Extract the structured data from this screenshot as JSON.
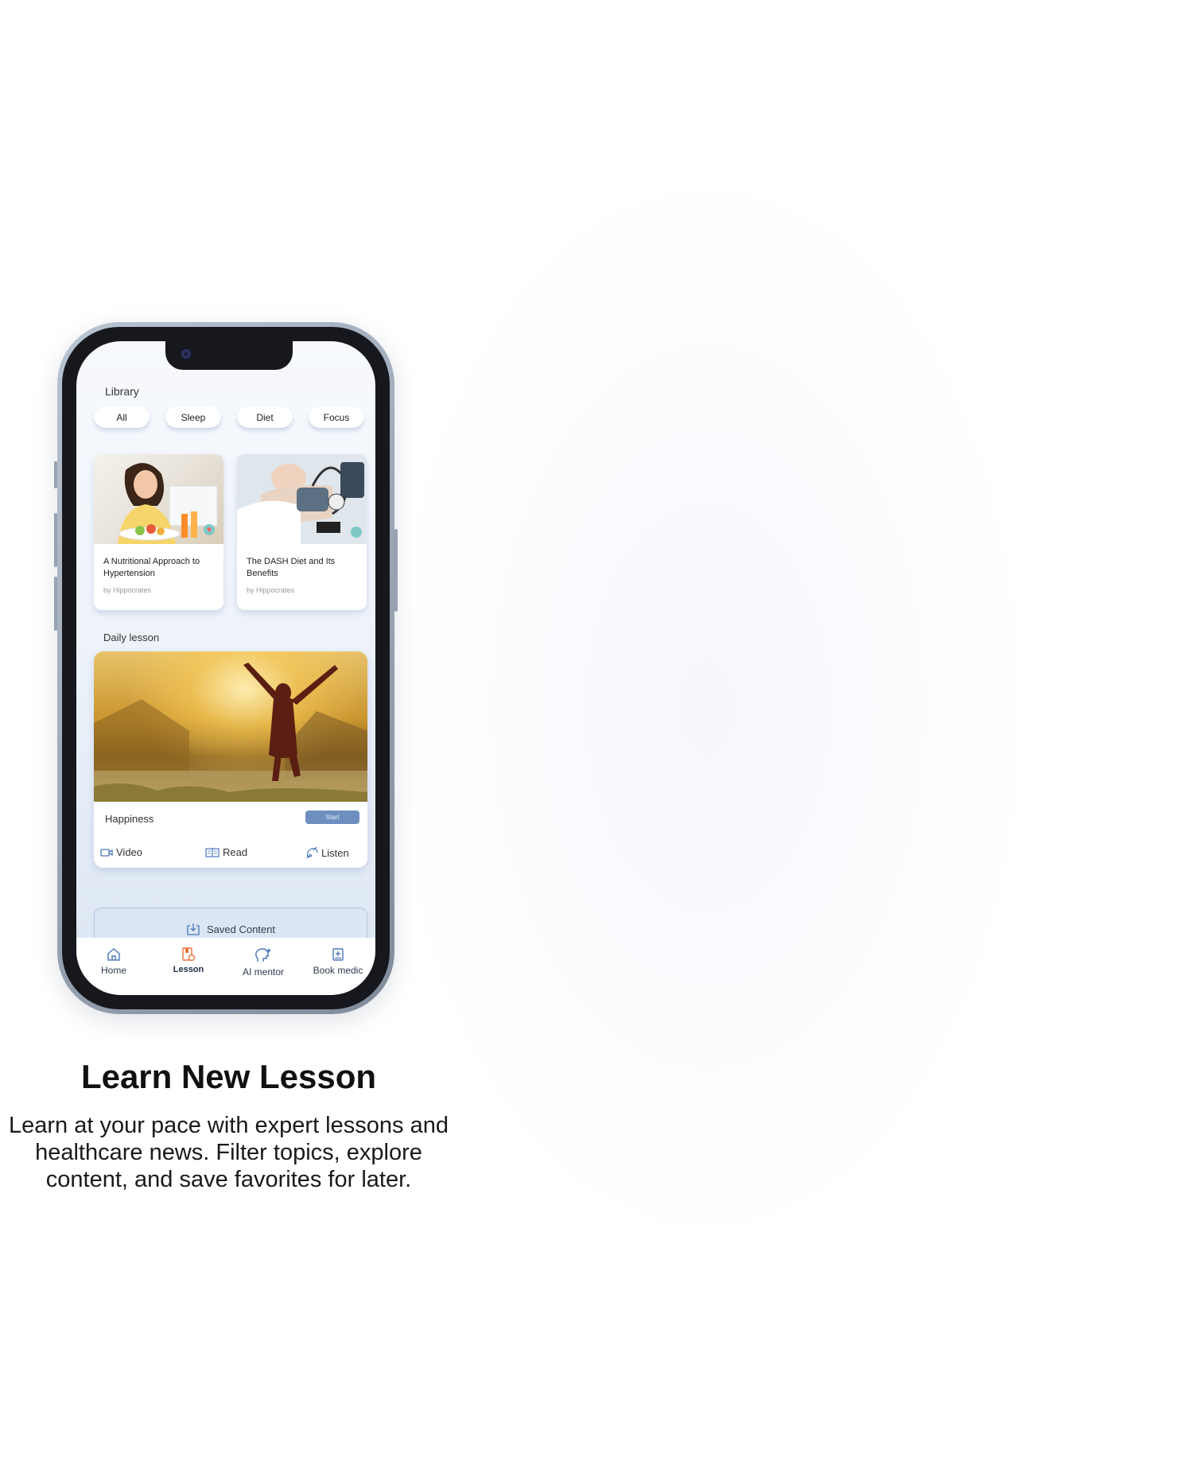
{
  "library": {
    "title": "Library",
    "chips": [
      "All",
      "Sleep",
      "Diet",
      "Focus"
    ]
  },
  "cards": [
    {
      "title": "A Nutritional Approach to Hypertension",
      "author": "by Hippocrates"
    },
    {
      "title": "The DASH Diet and Its Benefits",
      "author": "by Hippocrates"
    }
  ],
  "daily": {
    "title": "Daily lesson",
    "lesson_name": "Happiness",
    "start_label": "Start",
    "actions": {
      "video": "Video",
      "read": "Read",
      "listen": "Listen"
    }
  },
  "saved": {
    "label": "Saved Content"
  },
  "tabs": {
    "home": "Home",
    "lesson": "Lesson",
    "ai_mentor": "AI mentor",
    "book_medic": "Book medic"
  },
  "feature": {
    "headline": "Learn New Lesson",
    "description": "Learn at your pace with expert lessons and healthcare news. Filter topics, explore content, and save favorites for later."
  },
  "colors": {
    "accent": "#6d8fc0",
    "active_tab": "#e8743b",
    "icon_blue": "#4a78b8"
  }
}
